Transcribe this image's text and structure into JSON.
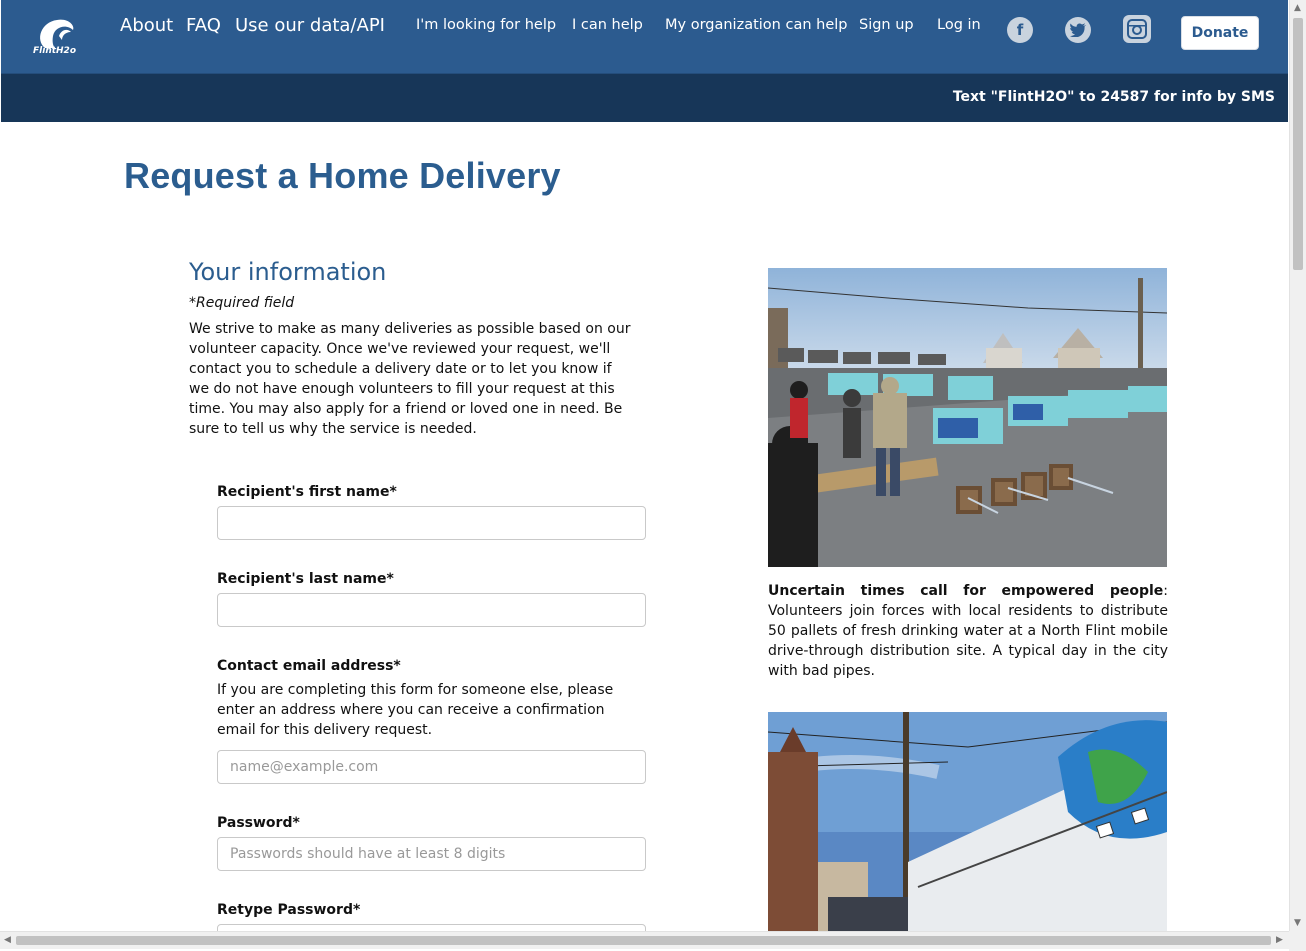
{
  "brand": {
    "logo_text": "FlintH2o"
  },
  "nav": {
    "main": [
      "About",
      "FAQ",
      "Use our data/API"
    ],
    "secondary": [
      "I'm looking for help",
      "I can help",
      "My organization can help",
      "Sign up",
      "Log in"
    ],
    "social_icons": [
      "facebook-icon",
      "twitter-icon",
      "instagram-icon"
    ],
    "donate_label": "Donate"
  },
  "sms_banner": "Text \"FlintH2O\" to 24587 for info by SMS",
  "page": {
    "title": "Request a Home Delivery",
    "section_title": "Your information",
    "required_note": "*Required field",
    "intro": "We strive to make as many deliveries as possible based on our volunteer capacity. Once we've reviewed your request, we'll contact you to schedule a delivery date or to let you know if we do not have enough volunteers to fill your request at this time. You may also apply for a friend or loved one in need. Be sure to tell us why the service is needed."
  },
  "form": {
    "first_name": {
      "label": "Recipient's first name*",
      "value": "",
      "placeholder": ""
    },
    "last_name": {
      "label": "Recipient's last name*",
      "value": "",
      "placeholder": ""
    },
    "email": {
      "label": "Contact email address*",
      "help": "If you are completing this form for someone else, please enter an address where you can receive a confirmation email for this delivery request.",
      "placeholder": "name@example.com"
    },
    "password": {
      "label": "Password*",
      "placeholder": "Passwords should have at least 8 digits"
    },
    "retype_password": {
      "label": "Retype Password*"
    }
  },
  "sidebar": {
    "caption_bold": "Uncertain times call for empowered people",
    "caption_rest": ": Volunteers join forces with local residents to distribute 50 pallets of fresh drinking water at a North Flint mobile drive-through distribution site. A typical day in the city with bad pipes."
  },
  "colors": {
    "nav_bg": "#2c5b8f",
    "sms_bg": "#173658",
    "title": "#2b5d8f"
  }
}
